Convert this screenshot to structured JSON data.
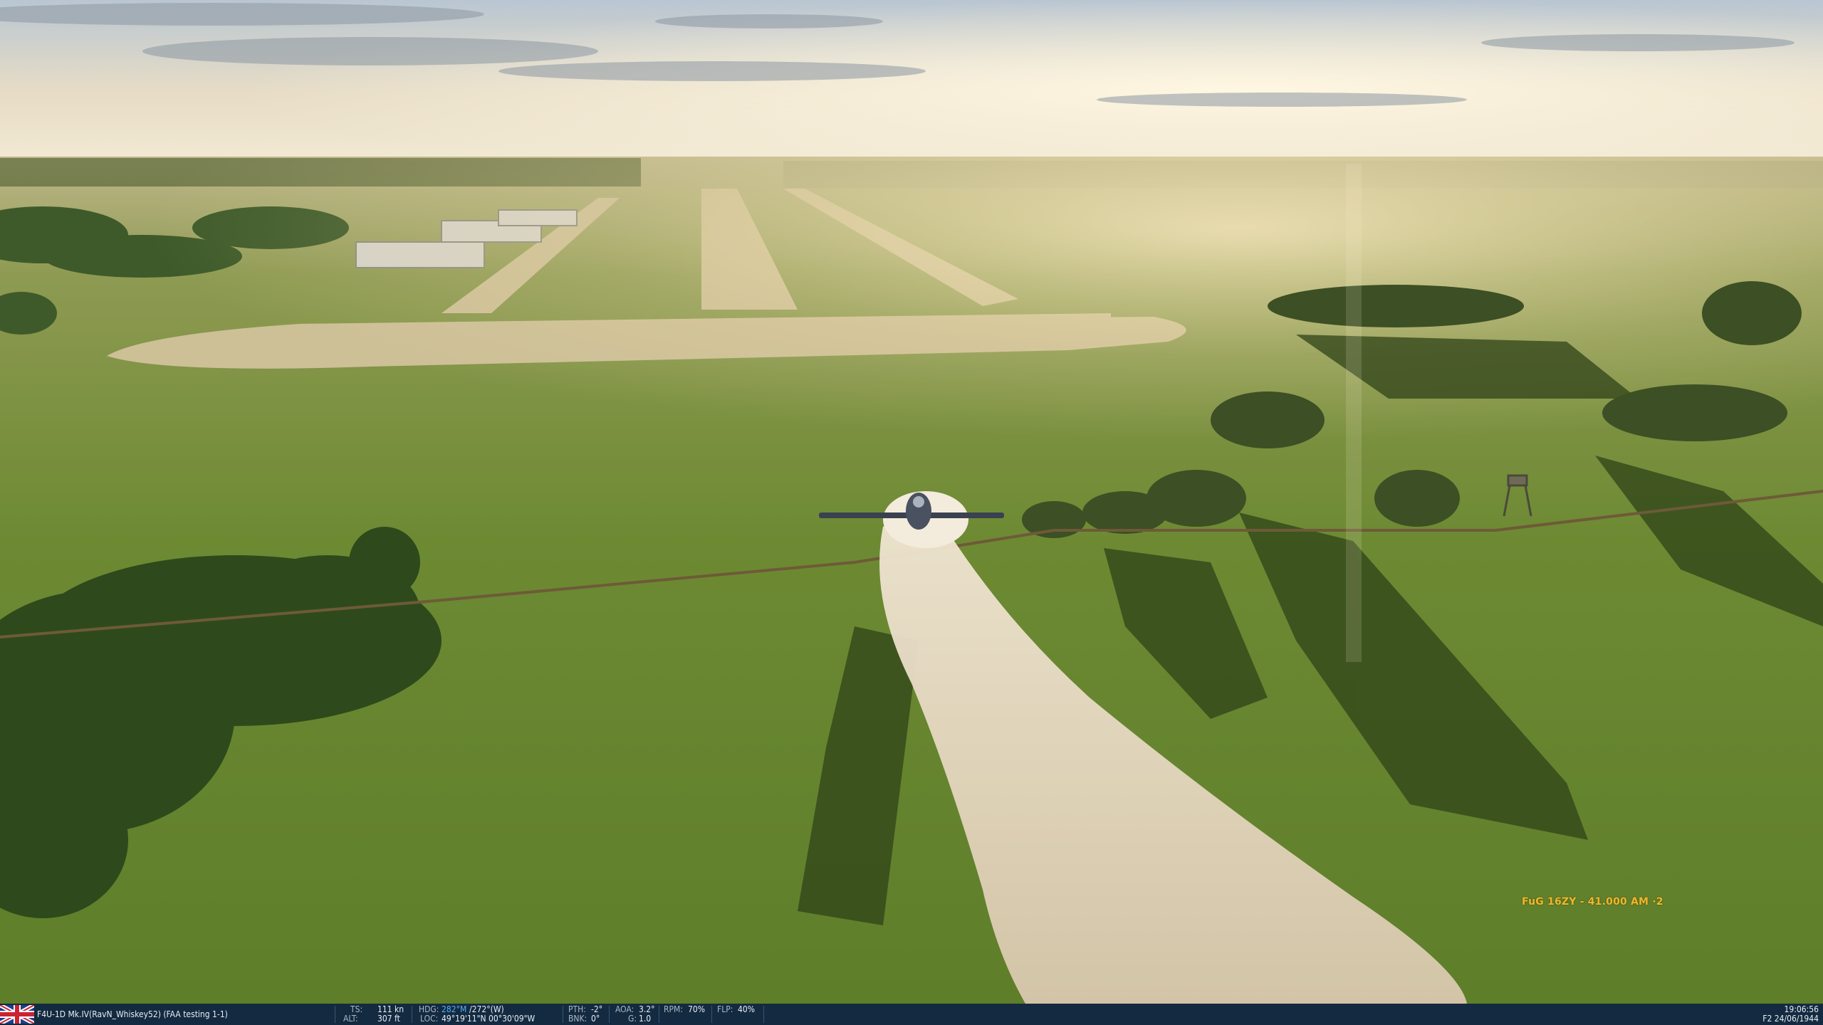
{
  "game": {
    "radio": {
      "label": "FuG 16ZY - 41.000 AM ·2",
      "color": "#f2b626"
    }
  },
  "hud": {
    "flag_icon": "uk-flag-icon",
    "aircraft": "F4U-1D Mk.IV(RavN_Whiskey52) (FAA testing 1-1)",
    "ts_label": "TS:",
    "ts_value": "111 kn",
    "alt_label": "ALT:",
    "alt_value": "307 ft",
    "hdg_label": "HDG:",
    "hdg_mag": "282°M",
    "hdg_true": "/272°(W)",
    "loc_label": "LOC:",
    "loc_value": "49°19'11\"N 00°30'09\"W",
    "pth_label": "PTH:",
    "pth_value": "-2°",
    "bnk_label": "BNK:",
    "bnk_value": "0°",
    "aoa_label": "AOA:",
    "aoa_value": "3.2°",
    "g_label": "G:",
    "g_value": "1.0",
    "rpm_label": "RPM:",
    "rpm_value": "70%",
    "flp_label": "FLP:",
    "flp_value": "40%",
    "time": "19:06:56",
    "date": "F2 24/06/1944",
    "colors": {
      "bar_bg": "#142a40",
      "heading_mag": "#4fb0ff"
    }
  }
}
